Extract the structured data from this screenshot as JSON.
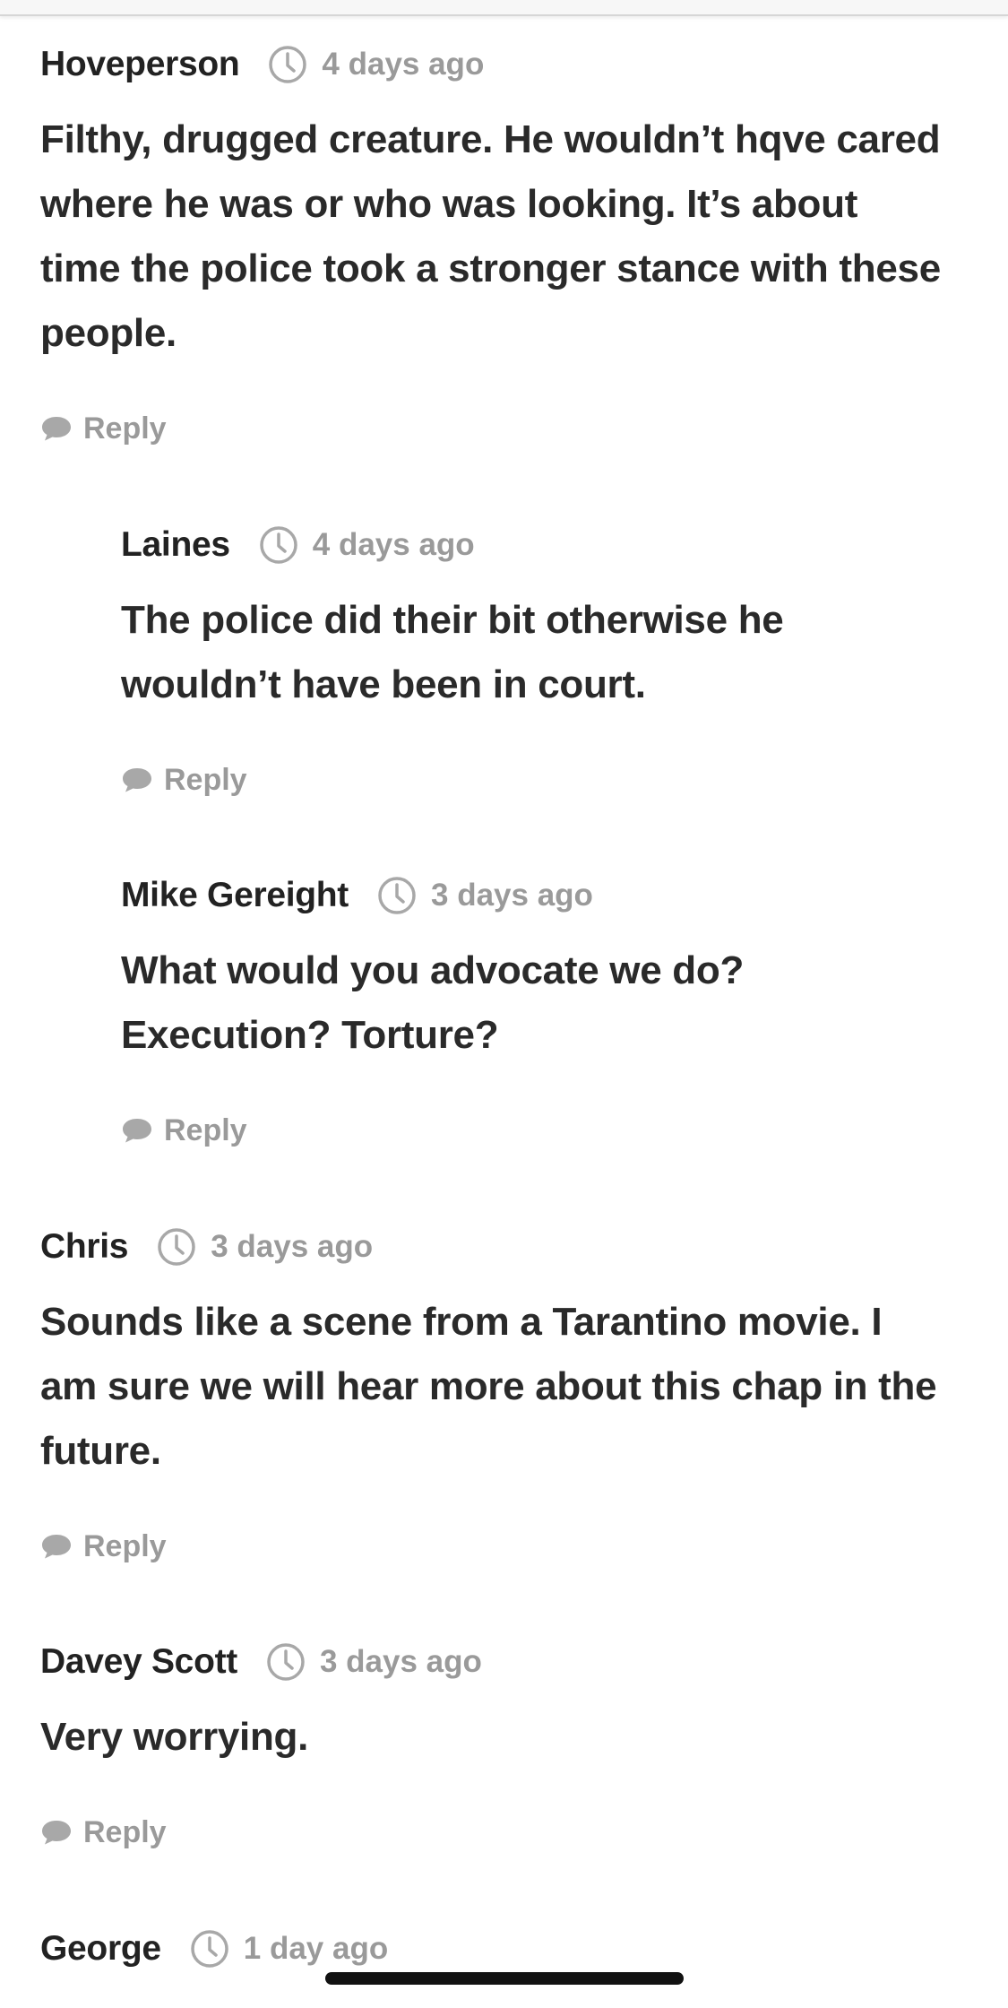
{
  "comments": [
    {
      "author": "Hoveperson",
      "time": "4 days ago",
      "text": "Filthy, drugged creature. He wouldn’t hqve cared where he was or who was looking. It’s about time the police took a stronger stance with these people.",
      "reply_label": "Reply"
    },
    {
      "author": "Laines",
      "time": "4 days ago",
      "text": "The police did their bit otherwise he wouldn’t have been in court.",
      "reply_label": "Reply"
    },
    {
      "author": "Mike Gereight",
      "time": "3 days ago",
      "text": "What would you advocate we do? Execution? Torture?",
      "reply_label": "Reply"
    },
    {
      "author": "Chris",
      "time": "3 days ago",
      "text": "Sounds like a scene from a Tarantino movie. I am sure we will hear more about this chap in the future.",
      "reply_label": "Reply"
    },
    {
      "author": "Davey Scott",
      "time": "3 days ago",
      "text": "Very worrying.",
      "reply_label": "Reply"
    },
    {
      "author": "George",
      "time": "1 day ago"
    }
  ],
  "colors": {
    "text": "#2a2a2a",
    "meta": "#9a9a9a",
    "background": "#ffffff"
  },
  "icons": {
    "time": "clock-icon",
    "reply": "speech-bubble-icon"
  }
}
